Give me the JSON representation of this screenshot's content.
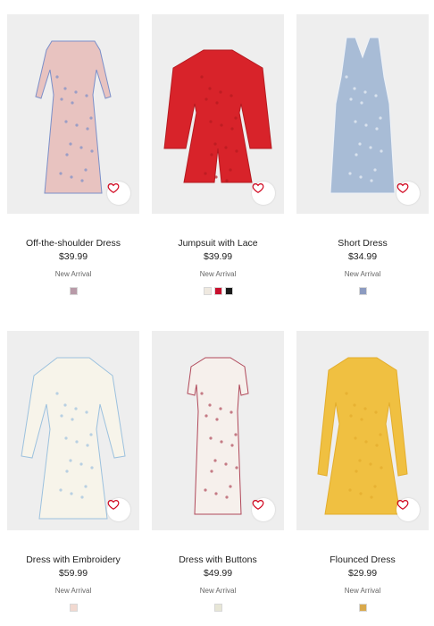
{
  "products": [
    {
      "name": "Off-the-shoulder Dress",
      "price": "$39.99",
      "badge": "New Arrival",
      "dress_color": "#e8c3c0",
      "pattern_color": "#7b8fc9",
      "swatches": [
        "#b89aa8"
      ]
    },
    {
      "name": "Jumpsuit with Lace",
      "price": "$39.99",
      "badge": "New Arrival",
      "dress_color": "#d8232a",
      "pattern_color": "#b51a20",
      "swatches": [
        "#efe9e0",
        "#c8102e",
        "#1b1b1b"
      ]
    },
    {
      "name": "Short Dress",
      "price": "$34.99",
      "badge": "New Arrival",
      "dress_color": "#a8bcd6",
      "pattern_color": "#eef2f8",
      "swatches": [
        "#8c9bc0"
      ]
    },
    {
      "name": "Dress with Embroidery",
      "price": "$59.99",
      "badge": "New Arrival",
      "dress_color": "#f7f4ea",
      "pattern_color": "#9cc1de",
      "swatches": [
        "#f2d9d0"
      ]
    },
    {
      "name": "Dress with Buttons",
      "price": "$49.99",
      "badge": "New Arrival",
      "dress_color": "#f6f0ec",
      "pattern_color": "#b0485a",
      "swatches": [
        "#e7e6d6"
      ]
    },
    {
      "name": "Flounced Dress",
      "price": "$29.99",
      "badge": "New Arrival",
      "dress_color": "#f0c041",
      "pattern_color": "#e3ad2c",
      "swatches": [
        "#d9a94c"
      ]
    }
  ],
  "icons": {
    "favorite": "heart-outline-icon"
  },
  "colors": {
    "accent": "#d0021b",
    "card_bg": "#eeeeee"
  }
}
